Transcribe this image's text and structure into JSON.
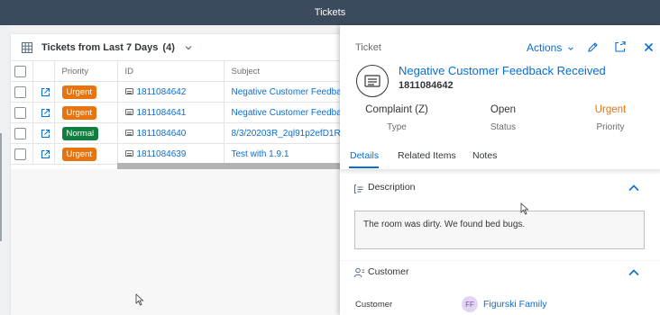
{
  "shell": {
    "title": "Tickets"
  },
  "list": {
    "title": "Tickets from Last 7 Days",
    "count": "(4)",
    "columns": [
      "Priority",
      "ID",
      "Subject"
    ],
    "rows": [
      {
        "priority": "Urgent",
        "priority_color": "#e9730c",
        "id": "1811084642",
        "subject": "Negative Customer Feedba"
      },
      {
        "priority": "Urgent",
        "priority_color": "#e9730c",
        "id": "1811084641",
        "subject": "Negative Customer Feedba"
      },
      {
        "priority": "Normal",
        "priority_color": "#107e3e",
        "id": "1811084640",
        "subject": "8/3/20203R_2ql91p2efD1R"
      },
      {
        "priority": "Urgent",
        "priority_color": "#e9730c",
        "id": "1811084639",
        "subject": "Test with 1.9.1"
      }
    ]
  },
  "detail": {
    "kicker": "Ticket",
    "actions_label": "Actions",
    "title": "Negative Customer Feedback Received",
    "id": "1811084642",
    "kpis": [
      {
        "value": "Complaint (Z)",
        "label": "Type",
        "color": "#32363a"
      },
      {
        "value": "Open",
        "label": "Status",
        "color": "#32363a"
      },
      {
        "value": "Urgent",
        "label": "Priority",
        "color": "#e9730c"
      }
    ],
    "tabs": [
      "Details",
      "Related Items",
      "Notes"
    ],
    "description": {
      "title": "Description",
      "text": "The room was dirty.  We found bed bugs."
    },
    "customer": {
      "title": "Customer",
      "field_label": "Customer",
      "initials": "FF",
      "name": "Figurski Family"
    }
  },
  "icons": [
    "grid-icon",
    "chevron-down-icon",
    "external-link-icon",
    "ticket-icon",
    "edit-icon",
    "share-icon",
    "close-icon",
    "text-icon",
    "person-icon",
    "chevron-up-icon",
    "mouse-cursor-icon"
  ]
}
